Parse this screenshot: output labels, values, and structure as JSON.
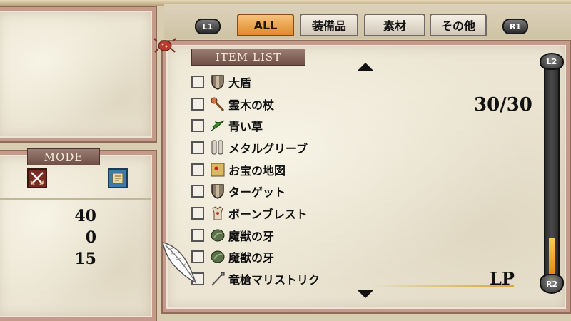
{
  "tabs": {
    "l1": "L1",
    "r1": "R1",
    "items": [
      {
        "label": "ALL",
        "active": true
      },
      {
        "label": "装備品",
        "active": false
      },
      {
        "label": "素材",
        "active": false
      },
      {
        "label": "その他",
        "active": false
      }
    ]
  },
  "item_list": {
    "title": "ITEM LIST",
    "durability": "30/30",
    "lp_label": "LP",
    "items": [
      {
        "name": "大盾",
        "icon": "shield-icon"
      },
      {
        "name": "霊木の杖",
        "icon": "staff-icon"
      },
      {
        "name": "青い草",
        "icon": "herb-icon"
      },
      {
        "name": "メタルグリーブ",
        "icon": "greaves-icon"
      },
      {
        "name": "お宝の地図",
        "icon": "map-icon"
      },
      {
        "name": "ターゲット",
        "icon": "shield-icon"
      },
      {
        "name": "ボーンブレスト",
        "icon": "armor-icon"
      },
      {
        "name": "魔獣の牙",
        "icon": "fang-icon"
      },
      {
        "name": "魔獣の牙",
        "icon": "fang-icon"
      },
      {
        "name": "竜槍マリストリク",
        "icon": "spear-icon"
      }
    ]
  },
  "scrollbar": {
    "top_label": "L2",
    "bottom_label": "R2",
    "fill_fraction": 0.18,
    "fill_color": "#f0a020"
  },
  "mode": {
    "title": "MODE",
    "icons": [
      "crossed-swords-icon",
      "scroll-icon"
    ],
    "stats": [
      "40",
      "0",
      "15"
    ]
  },
  "colors": {
    "active_tab": "#e08a2a",
    "frame": "#c49a8a",
    "cursor": "#ffffff"
  }
}
